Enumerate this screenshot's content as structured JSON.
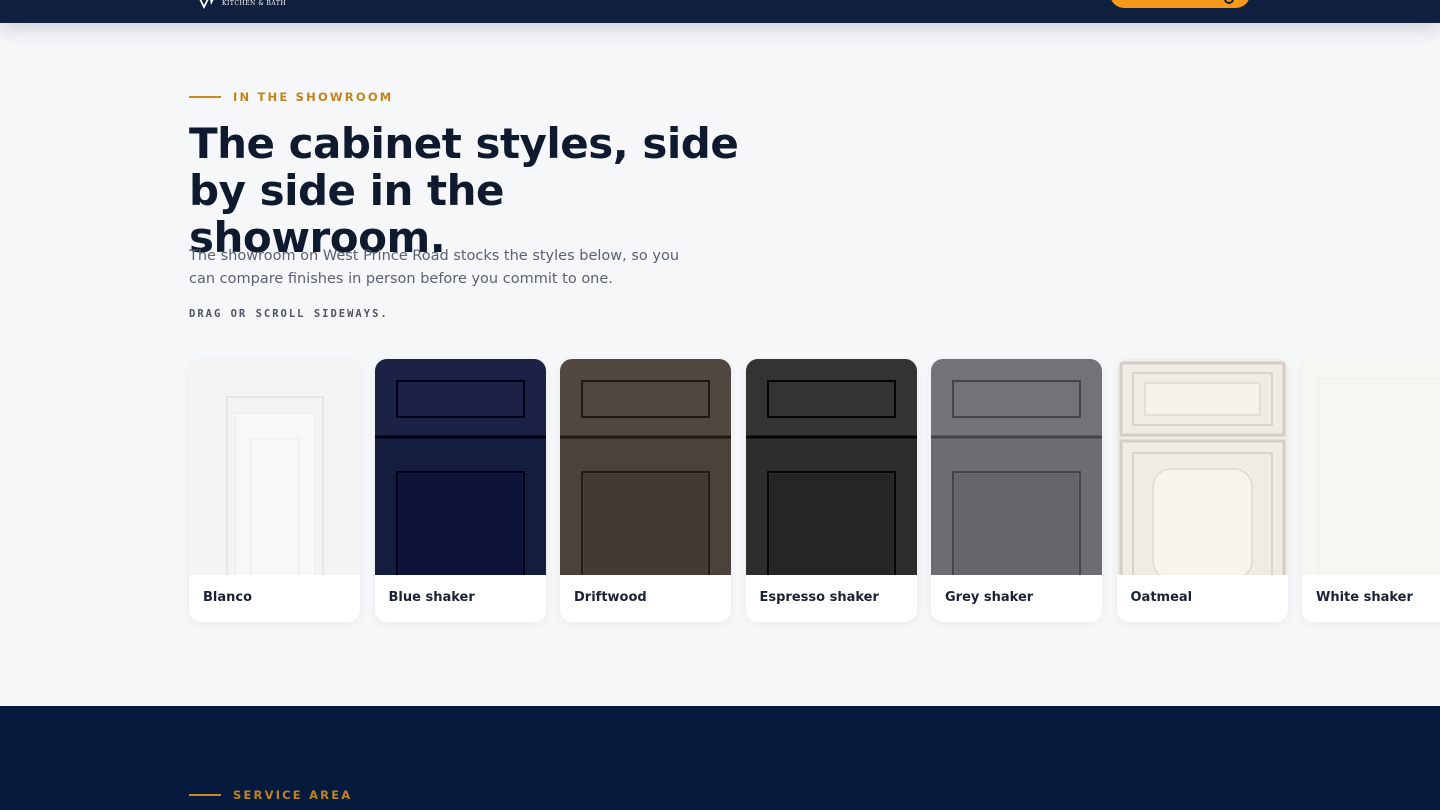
{
  "header": {
    "logo_text": "KITCHEN & BATH",
    "brand_color": "#0f1f3d",
    "cta_color": "#f59a1b"
  },
  "showroom": {
    "eyebrow": "IN THE SHOWROOM",
    "title": "The cabinet styles, side by side in the showroom.",
    "intro": "The showroom on West Prince Road stocks the styles below, so you can compare finishes in person before you commit to one.",
    "hint": "DRAG OR SCROLL SIDEWAYS.",
    "accent_color": "#c0841c",
    "styles": [
      {
        "label": "Blanco",
        "style": "raised",
        "finish": "#f4f4f4"
      },
      {
        "label": "Blue shaker",
        "style": "shaker",
        "finish": "#151d3f"
      },
      {
        "label": "Driftwood",
        "style": "shaker",
        "finish": "#4d4239"
      },
      {
        "label": "Espresso shaker",
        "style": "shaker",
        "finish": "#2e2d2b"
      },
      {
        "label": "Grey shaker",
        "style": "shaker",
        "finish": "#6c6d70"
      },
      {
        "label": "Oatmeal",
        "style": "ornate",
        "finish": "#eeece4"
      },
      {
        "label": "White shaker",
        "style": "plain",
        "finish": "#f6f6f3"
      }
    ]
  },
  "service_area": {
    "eyebrow": "SERVICE AREA",
    "background": "#051a3d"
  }
}
